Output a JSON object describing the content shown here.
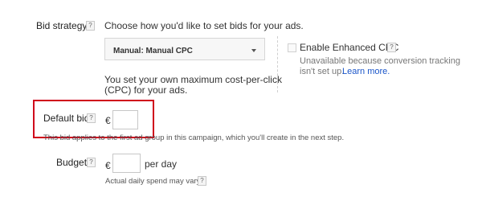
{
  "bid_strategy": {
    "label": "Bid strategy",
    "help": "?",
    "prompt": "Choose how you'd like to set bids for your ads.",
    "dropdown_value": "Manual: Manual CPC",
    "description_line1": "You set your own maximum cost-per-click",
    "description_line2": "(CPC) for your ads.",
    "enhanced_cpc_label": "Enable Enhanced CPC",
    "enhanced_cpc_help": "?",
    "unavailable_line1": "Unavailable because conversion tracking",
    "unavailable_line2": "isn't set up.",
    "learn_more": "Learn more."
  },
  "default_bid": {
    "label": "Default bid",
    "help": "?",
    "currency": "€",
    "value": "",
    "note": "This bid applies to the first ad group in this campaign, which you'll create in the next step."
  },
  "budget": {
    "label": "Budget",
    "help": "?",
    "currency": "€",
    "value": "",
    "per_day": "per day",
    "note": "Actual daily spend may vary.",
    "note_help": "?"
  },
  "colors": {
    "highlight": "#d0021b",
    "link": "#1a55c9"
  }
}
